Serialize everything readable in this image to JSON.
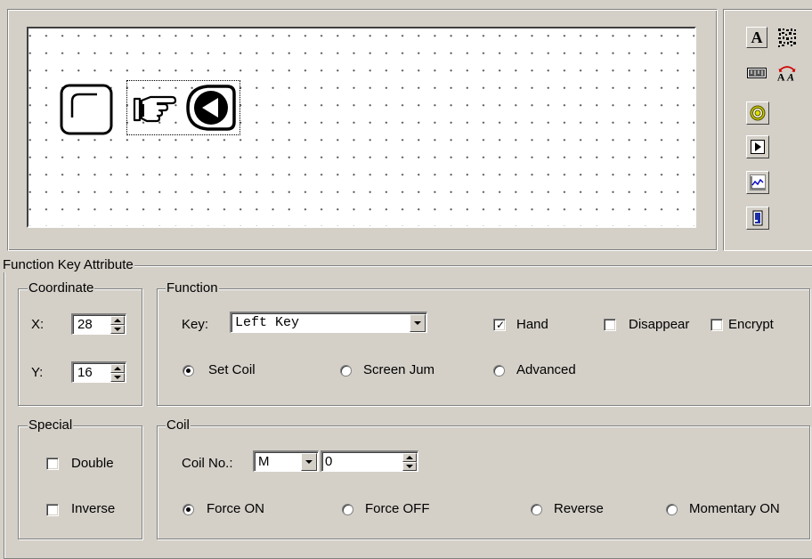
{
  "toolbar": {
    "items": [
      {
        "icon": "text-icon",
        "glyph": "A"
      },
      {
        "icon": "qr-pattern-icon"
      },
      {
        "icon": "ruler-icon"
      },
      {
        "icon": "font-size-icon",
        "glyph": "ÂA"
      },
      {
        "icon": "lamp-icon"
      },
      {
        "icon": "play-button-icon"
      },
      {
        "icon": "trend-chart-icon"
      },
      {
        "icon": "exit-door-icon"
      }
    ]
  },
  "attributes": {
    "title": "Function Key Attribute",
    "coordinate": {
      "title": "Coordinate",
      "x_label": "X:",
      "x_value": "28",
      "y_label": "Y:",
      "y_value": "16"
    },
    "function": {
      "title": "Function",
      "key_label": "Key:",
      "key_value": "Left Key",
      "hand_label": "Hand",
      "hand_checked": true,
      "disappear_label": "Disappear",
      "encrypt_label": "Encrypt",
      "set_coil_label": "Set Coil",
      "screen_jump_label": "Screen Jump",
      "advanced_label": "Advanced",
      "selected": "Set Coil"
    },
    "special": {
      "title": "Special",
      "double_label": "Double",
      "inverse_label": "Inverse"
    },
    "coil": {
      "title": "Coil",
      "coil_no_label": "Coil No.:",
      "coil_type": "M",
      "coil_number": "0",
      "force_on_label": "Force ON",
      "force_off_label": "Force OFF",
      "reverse_label": "Reverse",
      "momentary_on_label": "Momentary ON",
      "selected": "Force ON"
    }
  }
}
